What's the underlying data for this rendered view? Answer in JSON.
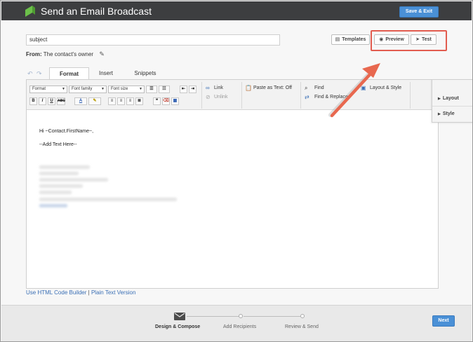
{
  "header": {
    "title": "Send an Email Broadcast",
    "save_exit_label": "Save & Exit"
  },
  "subject": {
    "value": "subject"
  },
  "from": {
    "label": "From:",
    "value": "The contact's owner"
  },
  "actions": {
    "templates_label": "Templates",
    "preview_label": "Preview",
    "test_label": "Test"
  },
  "tabs": [
    {
      "label": "Format",
      "active": true
    },
    {
      "label": "Insert",
      "active": false
    },
    {
      "label": "Snippets",
      "active": false
    }
  ],
  "toolbar": {
    "format_select": "Format",
    "font_family_select": "Font family",
    "font_size_select": "Font size",
    "link": "Link",
    "unlink": "Unlink",
    "paste_text": "Paste as Text: Off",
    "find": "Find",
    "find_replace": "Find & Replace",
    "layout_style": "Layout & Style"
  },
  "email": {
    "greeting": "Hi ~Contact.FirstName~,",
    "placeholder": "--Add Text Here--"
  },
  "side_panel": {
    "layout": "Layout",
    "style": "Style"
  },
  "links": {
    "html_builder": "Use HTML Code Builder",
    "separator": "|",
    "plain_text": "Plain Text Version"
  },
  "steps": [
    {
      "label": "Design & Compose",
      "active": true
    },
    {
      "label": "Add Recipients",
      "active": false
    },
    {
      "label": "Review & Send",
      "active": false
    }
  ],
  "footer": {
    "next_label": "Next"
  },
  "colors": {
    "accent": "#4a90d6",
    "header_bg": "#3d3e40",
    "highlight": "#e25c4f",
    "logo": "#6cc04a"
  }
}
